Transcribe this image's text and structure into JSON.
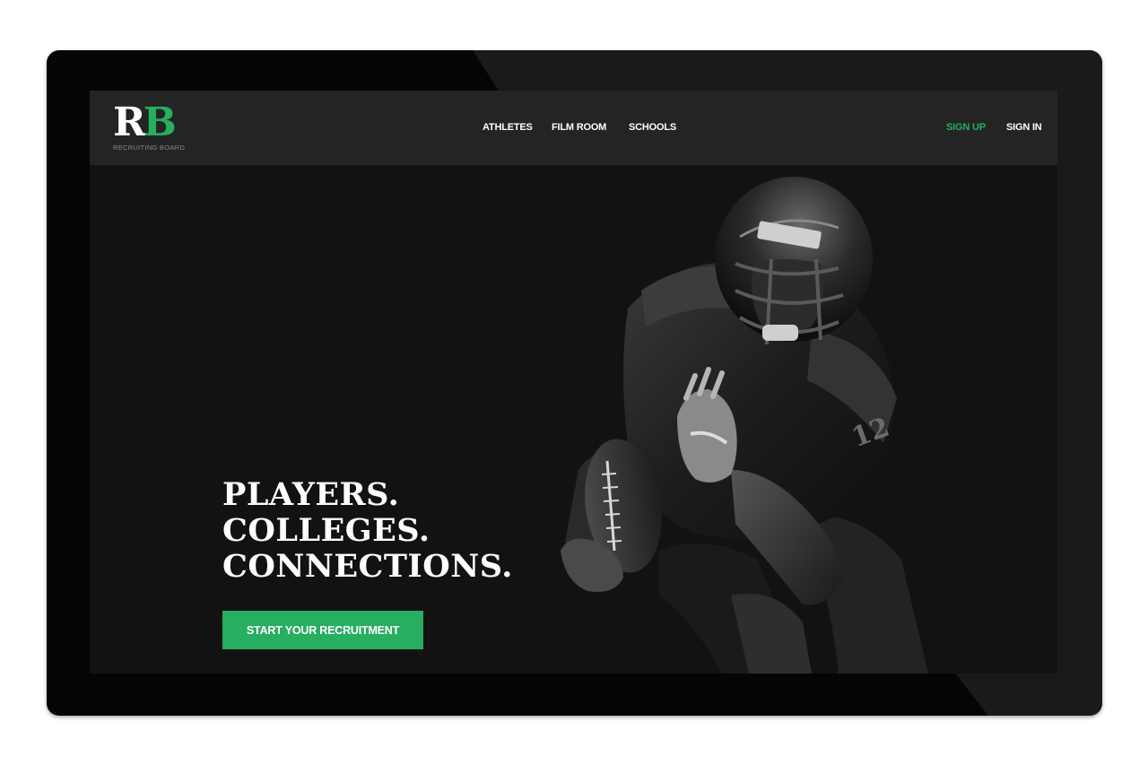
{
  "brand": {
    "logo_r": "R",
    "logo_b": "B",
    "tagline": "RECRUITING BOARD",
    "accent_color": "#27ae60"
  },
  "nav": {
    "links": [
      {
        "label": "ATHLETES"
      },
      {
        "label": "FILM ROOM"
      },
      {
        "label": "SCHOOLS"
      }
    ],
    "sign_up": "SIGN UP",
    "sign_in": "SIGN IN"
  },
  "hero": {
    "headline_lines": [
      "PLAYERS.",
      "COLLEGES.",
      "CONNECTIONS."
    ],
    "cta_label": "START YOUR RECRUITMENT",
    "image": "football-player-photo"
  }
}
